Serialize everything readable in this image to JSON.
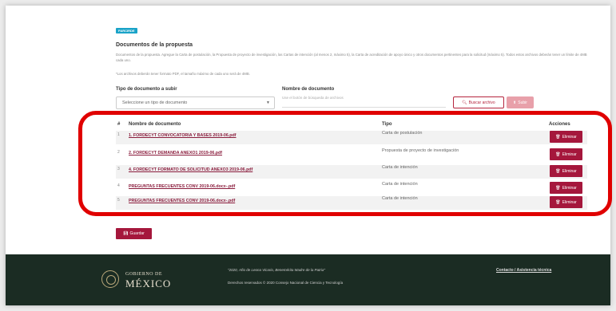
{
  "badge": "PARCIRDE",
  "section_title": "Documentos de la propuesta",
  "description": "Documentos de la propuesta. Agregue la Carta de postulación, la Propuesta de proyecto de investigación, las Cartas de intención (al menos 2, máximo 5), la Carta de acreditación de apoyo único y otros documentos pertinentes para la solicitud (máximo 5). Todos estos archivos deberán tener un límite de 4MB cada uno.",
  "note": "*Los archivos deberán tener formato PDF, el tamaño máximo de cada uno será de 4MB.",
  "form": {
    "type_label": "Tipo de documento a subir",
    "type_value": "Seleccione un tipo de documento",
    "name_label": "Nombre de documento",
    "name_placeholder": "Use el botón de búsqueda de archivos",
    "browse_label": "Buscar archivo",
    "upload_label": "Subir"
  },
  "table": {
    "headers": {
      "num": "#",
      "name": "Nombre de documento",
      "type": "Tipo",
      "actions": "Acciones"
    },
    "rows": [
      {
        "num": "1",
        "name": "1. FORDECYT CONVOCATORIA Y BASES 2019-06.pdf",
        "type": "Carta de postulación",
        "action": "Eliminar"
      },
      {
        "num": "2",
        "name": "2. FORDECYT DEMANDA ANEXO1 2019-06.pdf",
        "type": "Propuesta de proyecto de investigación",
        "action": "Eliminar"
      },
      {
        "num": "3",
        "name": "4. FORDECYT FORMATO DE SOLICITUD ANEXO3 2019-06.pdf",
        "type": "Carta de intención",
        "action": "Eliminar"
      },
      {
        "num": "4",
        "name": "PREGUNTAS FRECUENTES CONV 2019-06.docx-.pdf",
        "type": "Carta de intención",
        "action": "Eliminar"
      },
      {
        "num": "5",
        "name": "PREGUNTAS FRECUENTES CONV 2019-06.docx-.pdf",
        "type": "Carta de intención",
        "action": "Eliminar"
      }
    ]
  },
  "save_label": "Guardar",
  "footer": {
    "gob_line1": "GOBIERNO DE",
    "gob_line2": "MÉXICO",
    "quote": "\"2020, Año de Leona Vicario, Benemérita Madre de la Patria\"",
    "rights": "Derechos reservados © 2020 Consejo Nacional de Ciencia y Tecnología",
    "contact": "Contacto / Asistencia técnica"
  },
  "colors": {
    "accent": "#a5173c",
    "highlight": "#e00000",
    "footer_bg": "#1b2c23"
  }
}
